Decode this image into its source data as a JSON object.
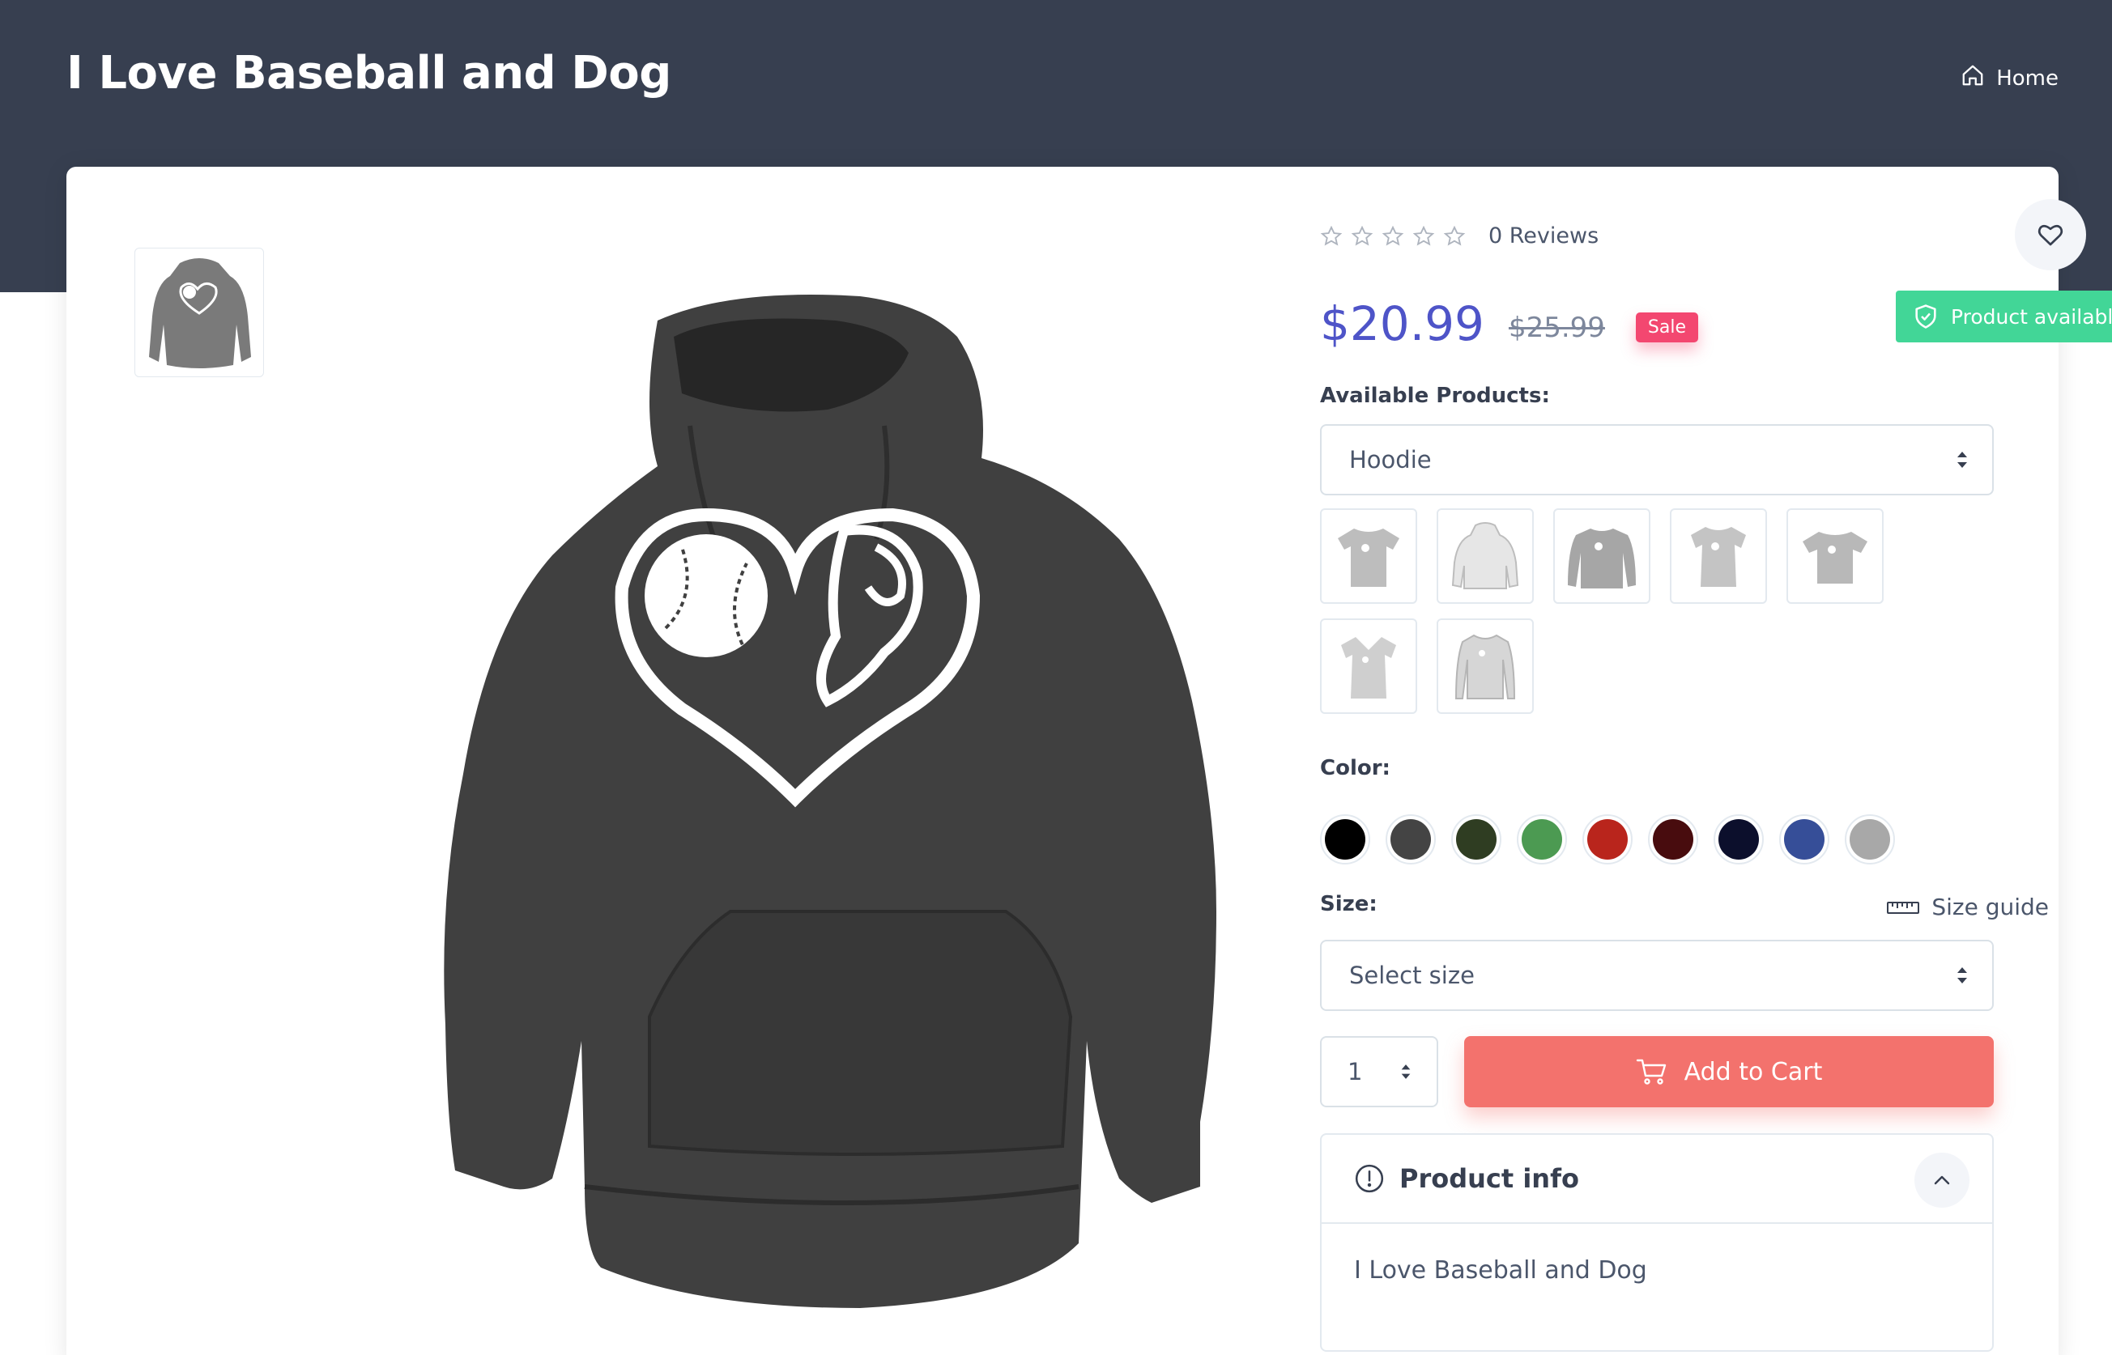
{
  "header": {
    "title": "I Love Baseball and Dog",
    "breadcrumb_home": "Home"
  },
  "gallery": {
    "icon": "hoodie-thumbnail",
    "main_image_icon": "hoodie-baseball-dog-print"
  },
  "product": {
    "rating_stars": 0,
    "max_stars": 5,
    "reviews_label": "0 Reviews",
    "price": "$20.99",
    "old_price": "$25.99",
    "sale_badge": "Sale",
    "availability": "Product available"
  },
  "available_products": {
    "label": "Available Products:",
    "selected": "Hoodie",
    "styles": [
      "tshirt",
      "hoodie-white",
      "sweatshirt",
      "tshirt-fitted",
      "tshirt-unisex",
      "vneck",
      "longsleeve"
    ]
  },
  "color": {
    "label": "Color:",
    "swatches": [
      "#000000",
      "#444444",
      "#2f3d22",
      "#4c9a52",
      "#b9251c",
      "#480c0e",
      "#0c0f2c",
      "#364e98",
      "#a8a8a8"
    ]
  },
  "size": {
    "label": "Size:",
    "guide_label": "Size guide",
    "placeholder": "Select size"
  },
  "cart": {
    "quantity": "1",
    "add_label": "Add to Cart"
  },
  "product_info": {
    "title": "Product info",
    "body": "I Love Baseball and Dog"
  },
  "colors": {
    "header_bg": "#373f50",
    "price": "#4e54c8",
    "sale": "#f34770",
    "available": "#42d697",
    "cart": "#f3726d"
  }
}
